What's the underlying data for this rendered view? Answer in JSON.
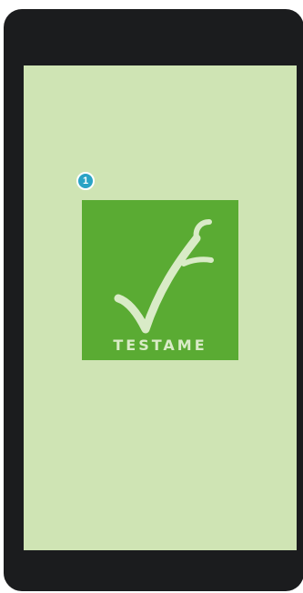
{
  "screen": {
    "background_color": "#cfe4b4"
  },
  "step_badge": {
    "number": "1",
    "color": "#2aa3c5"
  },
  "logo": {
    "text": "TESTAME",
    "icon": "checkmark-logo-icon",
    "background_color": "#5aab33"
  }
}
